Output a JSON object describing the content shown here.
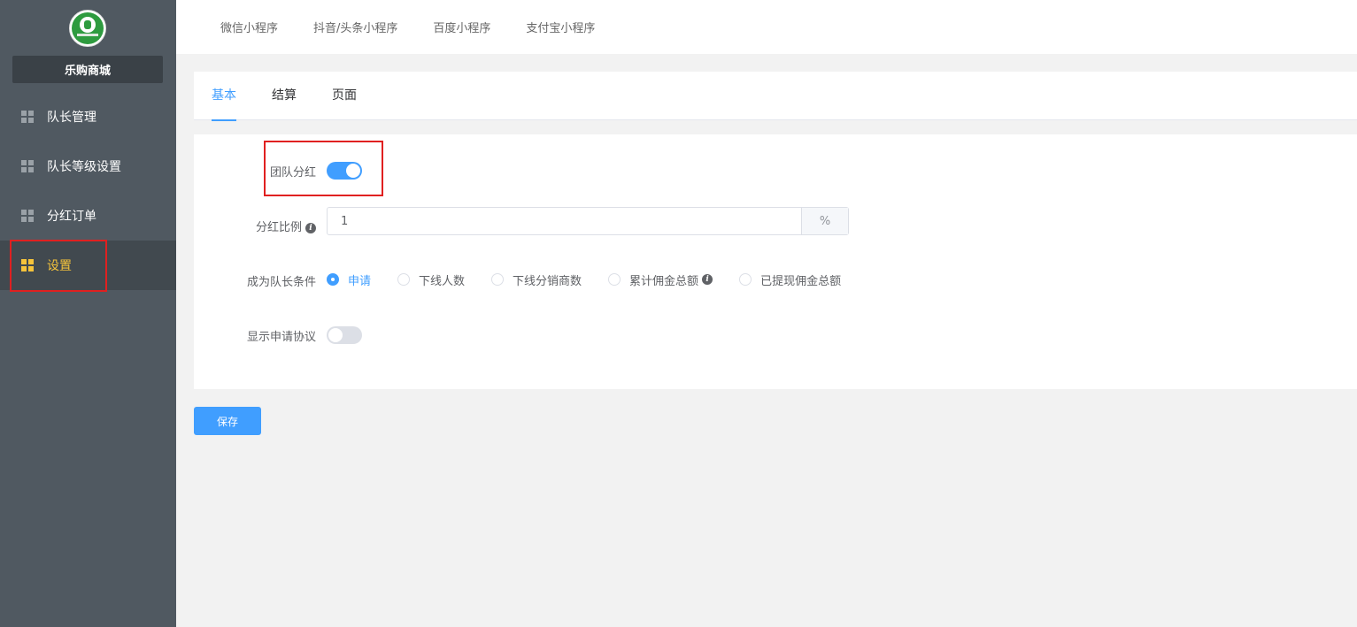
{
  "sidebar": {
    "shop_name": "乐购商城",
    "items": [
      {
        "label": "队长管理",
        "icon": "grid-icon",
        "active": false
      },
      {
        "label": "队长等级设置",
        "icon": "grid-icon",
        "active": false
      },
      {
        "label": "分红订单",
        "icon": "grid-icon",
        "active": false
      },
      {
        "label": "设置",
        "icon": "grid-icon",
        "active": true
      }
    ]
  },
  "topbar": {
    "tabs": [
      "微信小程序",
      "抖音/头条小程序",
      "百度小程序",
      "支付宝小程序"
    ]
  },
  "subtabs": {
    "items": [
      "基本",
      "结算",
      "页面"
    ],
    "active": "基本"
  },
  "form": {
    "team_bonus": {
      "label": "团队分红",
      "enabled": true
    },
    "bonus_ratio": {
      "label": "分红比例",
      "value": "1",
      "suffix": "%"
    },
    "captain_condition": {
      "label": "成为队长条件",
      "options": [
        "申请",
        "下线人数",
        "下线分销商数",
        "累计佣金总额",
        "已提现佣金总额"
      ],
      "selected": "申请"
    },
    "show_agreement": {
      "label": "显示申请协议",
      "enabled": false
    }
  },
  "actions": {
    "save_label": "保存"
  },
  "colors": {
    "primary": "#409eff",
    "sidebar_bg": "#505961",
    "active_menu": "#f5c33b",
    "highlight": "#e02020"
  }
}
